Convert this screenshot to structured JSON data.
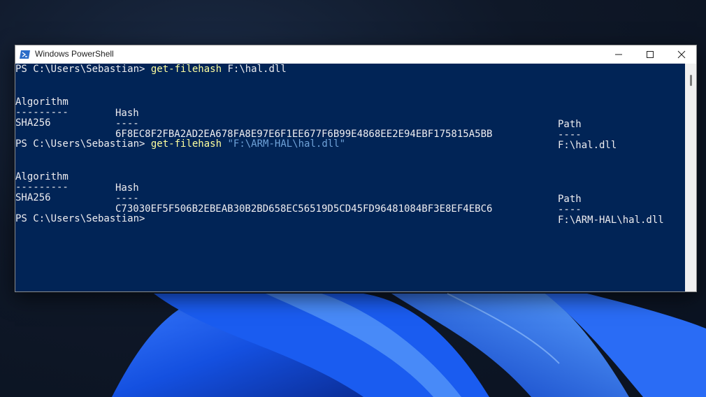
{
  "window": {
    "title": "Windows PowerShell",
    "controls": {
      "minimize": "minimize",
      "maximize": "maximize",
      "close": "close"
    }
  },
  "console": {
    "block1": {
      "prompt": "PS C:\\Users\\Sebastian> ",
      "command": "get-filehash",
      "argument": " F:\\hal.dll",
      "header_algorithm": "Algorithm",
      "header_hash": "Hash",
      "header_path": "Path",
      "sep_algorithm": "---------",
      "sep_hash": "----",
      "sep_path": "----",
      "row_algorithm": "SHA256",
      "row_hash": "6F8EC8F2FBA2AD2EA678FA8E97E6F1EE677F6B99E4868EE2E94EBF175815A5BB",
      "row_path": "F:\\hal.dll"
    },
    "block2": {
      "prompt": "PS C:\\Users\\Sebastian> ",
      "command": "get-filehash",
      "argument": " \"F:\\ARM-HAL\\hal.dll\"",
      "header_algorithm": "Algorithm",
      "header_hash": "Hash",
      "header_path": "Path",
      "sep_algorithm": "---------",
      "sep_hash": "----",
      "sep_path": "----",
      "row_algorithm": "SHA256",
      "row_hash": "C73030EF5F506B2EBEAB30B2BD658EC56519D5CD45FD96481084BF3E8EF4EBC6",
      "row_path": "F:\\ARM-HAL\\hal.dll"
    },
    "final_prompt": "PS C:\\Users\\Sebastian>"
  },
  "colors": {
    "console_bg": "#012456",
    "text": "#eeedf0",
    "command": "#ffff9f",
    "string": "#6fa2d9"
  }
}
